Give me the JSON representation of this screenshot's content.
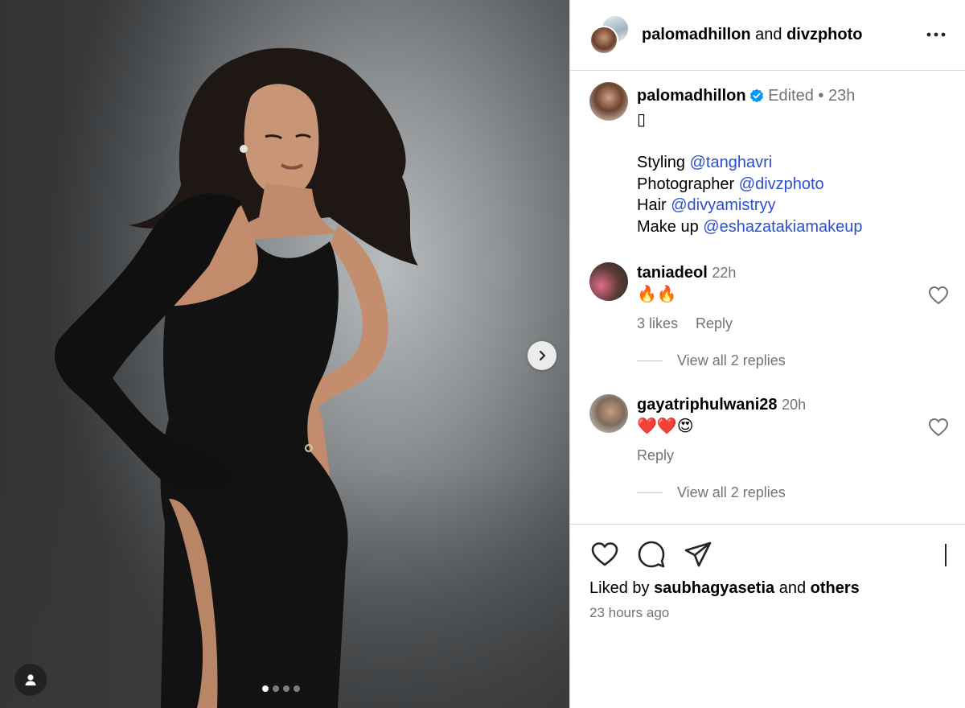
{
  "post": {
    "header": {
      "primary_user": "palomadhillon",
      "joiner": "and",
      "secondary_user": "divzphoto",
      "more_icon": "more-horizontal-icon"
    },
    "caption": {
      "username": "palomadhillon",
      "verified": true,
      "edited_label": "Edited",
      "separator": "•",
      "time": "23h",
      "glyph": "▯",
      "lines": [
        {
          "label": "Styling",
          "mention": "@tanghavri"
        },
        {
          "label": "Photographer",
          "mention": "@divzphoto"
        },
        {
          "label": "Hair",
          "mention": "@divyamistryy"
        },
        {
          "label": "Make up",
          "mention": "@eshazatakiamakeup"
        }
      ]
    },
    "comments": [
      {
        "username": "taniadeol",
        "time": "22h",
        "text": "🔥🔥",
        "likes": "3 likes",
        "reply": "Reply",
        "view_replies": "View all 2 replies"
      },
      {
        "username": "gayatriphulwani28",
        "time": "20h",
        "text": "❤️❤️😍",
        "reply": "Reply",
        "view_replies": "View all 2 replies"
      }
    ],
    "footer": {
      "liked_prefix": "Liked by",
      "liked_user": "saubhagyasetia",
      "liked_joiner": "and",
      "liked_others": "others",
      "timestamp": "23 hours ago"
    },
    "carousel": {
      "total_slides": 4,
      "current_slide": 1
    },
    "icons": {
      "like": "heart-outline-icon",
      "comment": "comment-bubble-icon",
      "share": "paper-plane-icon",
      "save": "bookmark-icon",
      "next": "chevron-right-icon",
      "tagged": "user-tag-icon",
      "verified": "verified-badge-icon"
    },
    "colors": {
      "mention": "#2b4fd1",
      "verified": "#0095f6",
      "muted": "#737373",
      "divider": "#dbdbdb"
    }
  }
}
